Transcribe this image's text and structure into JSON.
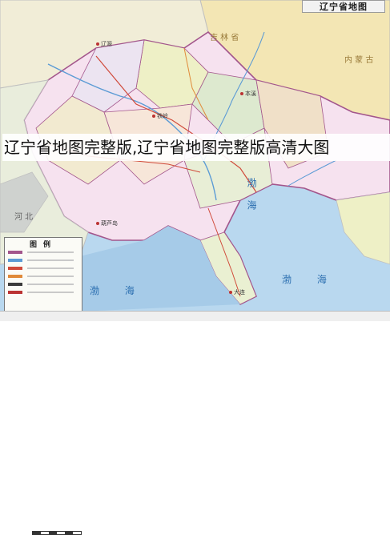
{
  "map": {
    "title": "辽宁省地图",
    "caption": "辽宁省地图完整版,辽宁省地图完整版高清大图",
    "legend_title": "图例",
    "regions": {
      "jilin": "吉 林 省",
      "inner_mongolia": "内 蒙 古",
      "hebei": "河 北"
    },
    "seas": {
      "bohai_upper": "渤 海",
      "bohai_lower": "渤 海",
      "bohai_east": "渤 海"
    },
    "cities": [
      "辽源",
      "本溪",
      "铁岭",
      "葫芦岛",
      "大连"
    ],
    "colors": {
      "land_jilin": "#f3e6b4",
      "land_liaoning_a": "#f6e2ef",
      "land_liaoning_b": "#eef0c6",
      "land_liaoning_c": "#dde9cf",
      "land_hebei": "#e9eddc",
      "sea": "#b9d8ef",
      "sea_deep": "#a6cbe8",
      "border": "#a3568c",
      "river": "#5b9bd5",
      "road": "#d04a3a"
    }
  }
}
